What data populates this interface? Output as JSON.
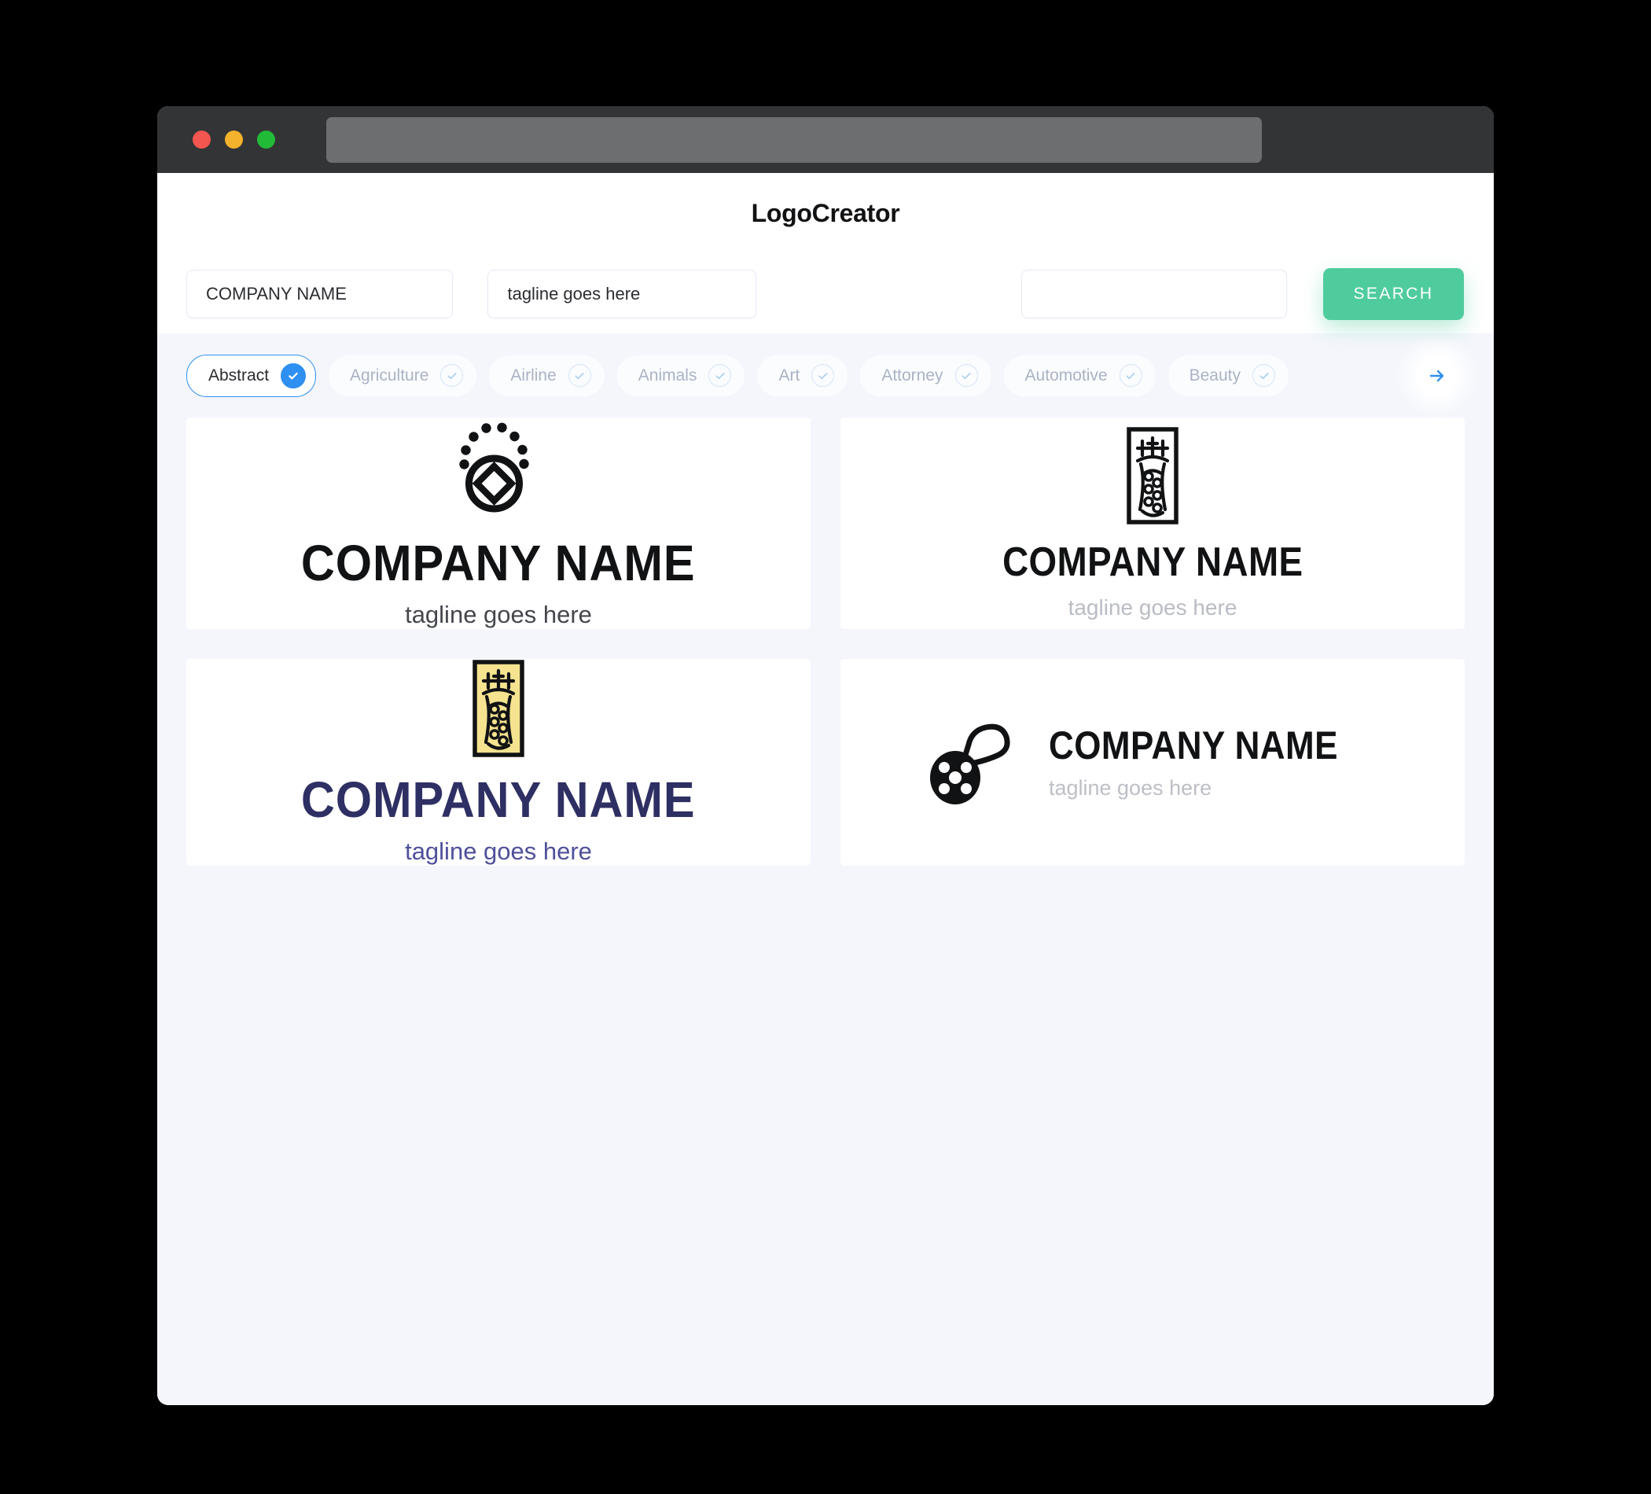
{
  "window": {
    "traffic_lights": [
      {
        "name": "close",
        "color": "#f2564f"
      },
      {
        "name": "minimize",
        "color": "#f5b22c"
      },
      {
        "name": "maximize",
        "color": "#22bb38"
      }
    ],
    "address_value": ""
  },
  "header": {
    "app_title": "LogoCreator"
  },
  "search": {
    "company_value": "COMPANY NAME",
    "company_placeholder": "COMPANY NAME",
    "tagline_value": "tagline goes here",
    "tagline_placeholder": "tagline goes here",
    "extra_value": "",
    "extra_placeholder": "",
    "button_label": "SEARCH",
    "button_color": "#4fcc9e"
  },
  "categories": {
    "active_color": "#2f90f2",
    "next_label": "→",
    "items": [
      {
        "label": "Abstract",
        "selected": true
      },
      {
        "label": "Agriculture",
        "selected": false
      },
      {
        "label": "Airline",
        "selected": false
      },
      {
        "label": "Animals",
        "selected": false
      },
      {
        "label": "Art",
        "selected": false
      },
      {
        "label": "Attorney",
        "selected": false
      },
      {
        "label": "Automotive",
        "selected": false
      },
      {
        "label": "Beauty",
        "selected": false
      }
    ]
  },
  "results": [
    {
      "icon": "dotted-arc-diamond-ring-icon",
      "name": "COMPANY NAME",
      "tagline": "tagline goes here",
      "name_color": "#111214",
      "tagline_color": "#45474d",
      "layout": "vertical"
    },
    {
      "icon": "ornate-rectangular-emblem-icon",
      "name": "COMPANY NAME",
      "tagline": "tagline goes here",
      "name_color": "#111214",
      "tagline_color": "#b9bcc4",
      "layout": "vertical"
    },
    {
      "icon": "ornate-rectangular-emblem-yellow-icon",
      "name": "COMPANY NAME",
      "tagline": "tagline goes here",
      "name_color": "#2e2f63",
      "tagline_color": "#4e509a",
      "badge_fill": "#f5e38f",
      "layout": "vertical"
    },
    {
      "icon": "film-reel-loop-icon",
      "name": "COMPANY NAME",
      "tagline": "tagline goes here",
      "name_color": "#111214",
      "tagline_color": "#bdbfc6",
      "layout": "horizontal"
    }
  ]
}
